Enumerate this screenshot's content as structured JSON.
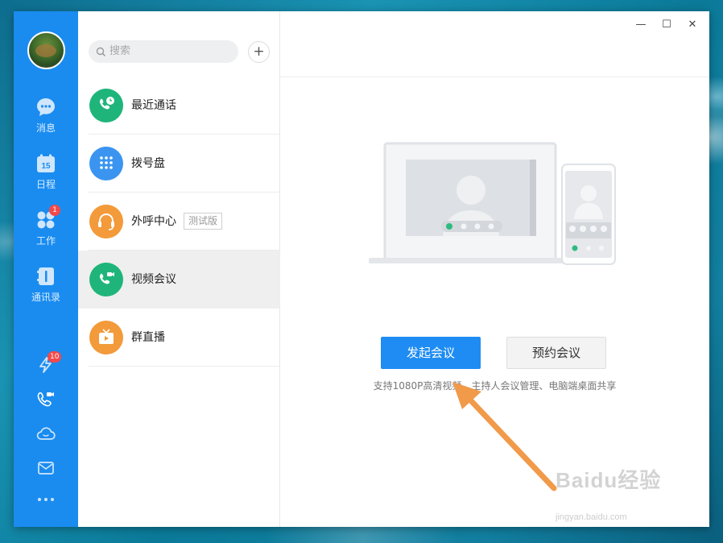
{
  "rail": {
    "items": [
      {
        "label": "消息"
      },
      {
        "label": "日程",
        "date": "15"
      },
      {
        "label": "工作",
        "badge": "1"
      },
      {
        "label": "通讯录"
      }
    ],
    "bottom": [
      {
        "icon": "lightning-icon",
        "badge": "10"
      },
      {
        "icon": "video-call-icon"
      },
      {
        "icon": "cloud-icon"
      },
      {
        "icon": "mail-icon"
      },
      {
        "icon": "more-icon"
      }
    ]
  },
  "list": {
    "search_placeholder": "搜索",
    "add_label": "+",
    "items": [
      {
        "label": "最近通话",
        "color": "#1fb57a"
      },
      {
        "label": "拨号盘",
        "color": "#3b95f0"
      },
      {
        "label": "外呼中心",
        "color": "#f39a3a",
        "tag": "测试版"
      },
      {
        "label": "视频会议",
        "color": "#1fb57a",
        "active": true
      },
      {
        "label": "群直播",
        "color": "#f39a3a"
      }
    ]
  },
  "content": {
    "window_controls": [
      "—",
      "☐",
      "✕"
    ],
    "start_button": "发起会议",
    "schedule_button": "预约会议",
    "description": "支持1080P高清视频、主持人会议管理、电脑端桌面共享"
  },
  "watermark": {
    "brand": "Baidu经验",
    "url": "jingyan.baidu.com"
  },
  "colors": {
    "rail": "#1a8cf0",
    "primary": "#1e8cf2",
    "annotation_arrow": "#f09a4a"
  }
}
